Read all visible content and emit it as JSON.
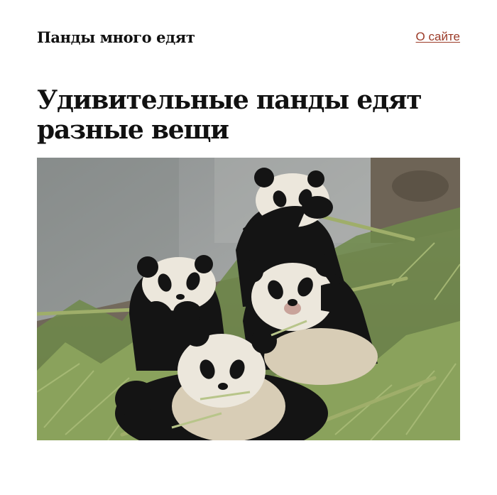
{
  "header": {
    "site_title": "Панды много едят",
    "about_link": "О сайте"
  },
  "article": {
    "title": "Удивительные панды едят разные вещи",
    "image": {
      "subject": "pandas-eating-bamboo-icon"
    }
  },
  "colors": {
    "link": "#9b3a27",
    "text": "#111111",
    "background": "#ffffff"
  }
}
